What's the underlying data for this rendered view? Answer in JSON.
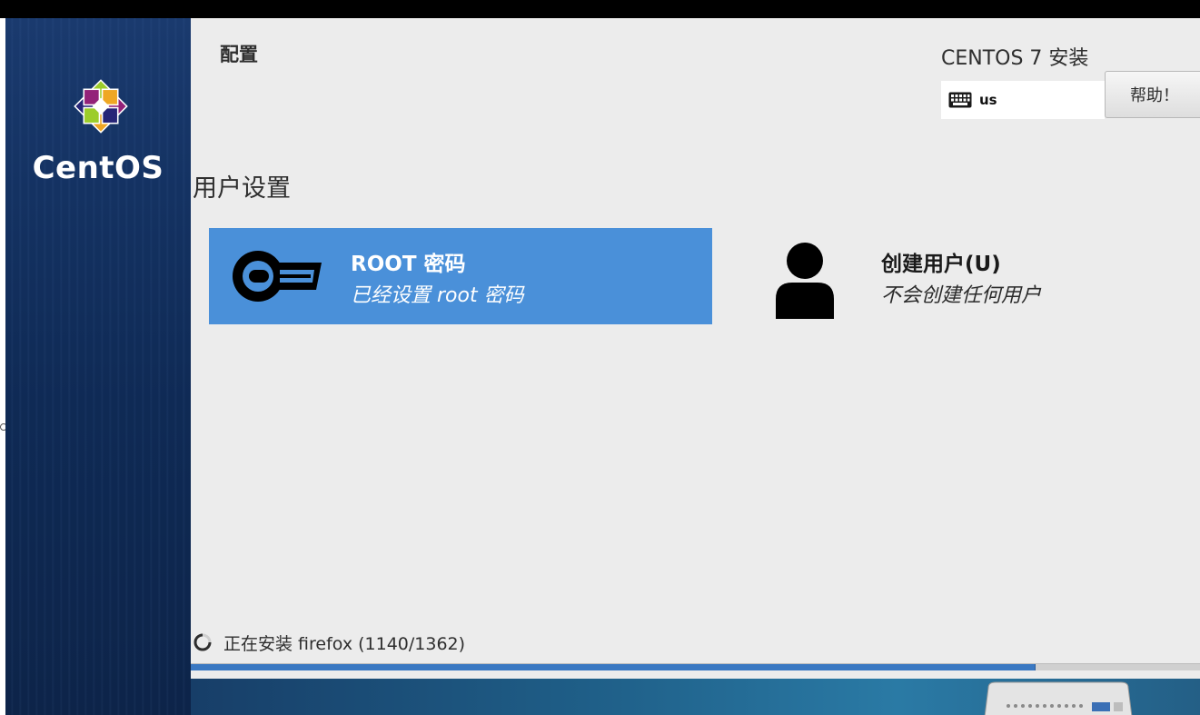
{
  "sidebar": {
    "logo_text": "CentOS"
  },
  "header": {
    "title": "配置",
    "product": "CENTOS 7 安装",
    "keyboard_layout": "us",
    "help_label": "帮助！"
  },
  "section": {
    "title": "用户设置"
  },
  "spokes": {
    "root": {
      "title": "ROOT 密码",
      "status": "已经设置 root 密码",
      "selected": true
    },
    "user": {
      "title": "创建用户(U)",
      "status": "不会创建任何用户"
    }
  },
  "progress": {
    "text": "正在安装 firefox (1140/1362)",
    "current": 1140,
    "total": 1362
  },
  "colors": {
    "accent": "#4a90d9",
    "sidebar": "#143262",
    "background": "#ececec"
  },
  "icons": {
    "logo": "centos-logo-icon",
    "keyboard": "keyboard-icon",
    "root": "key-icon",
    "user": "user-icon",
    "spinner": "spinner-icon"
  }
}
